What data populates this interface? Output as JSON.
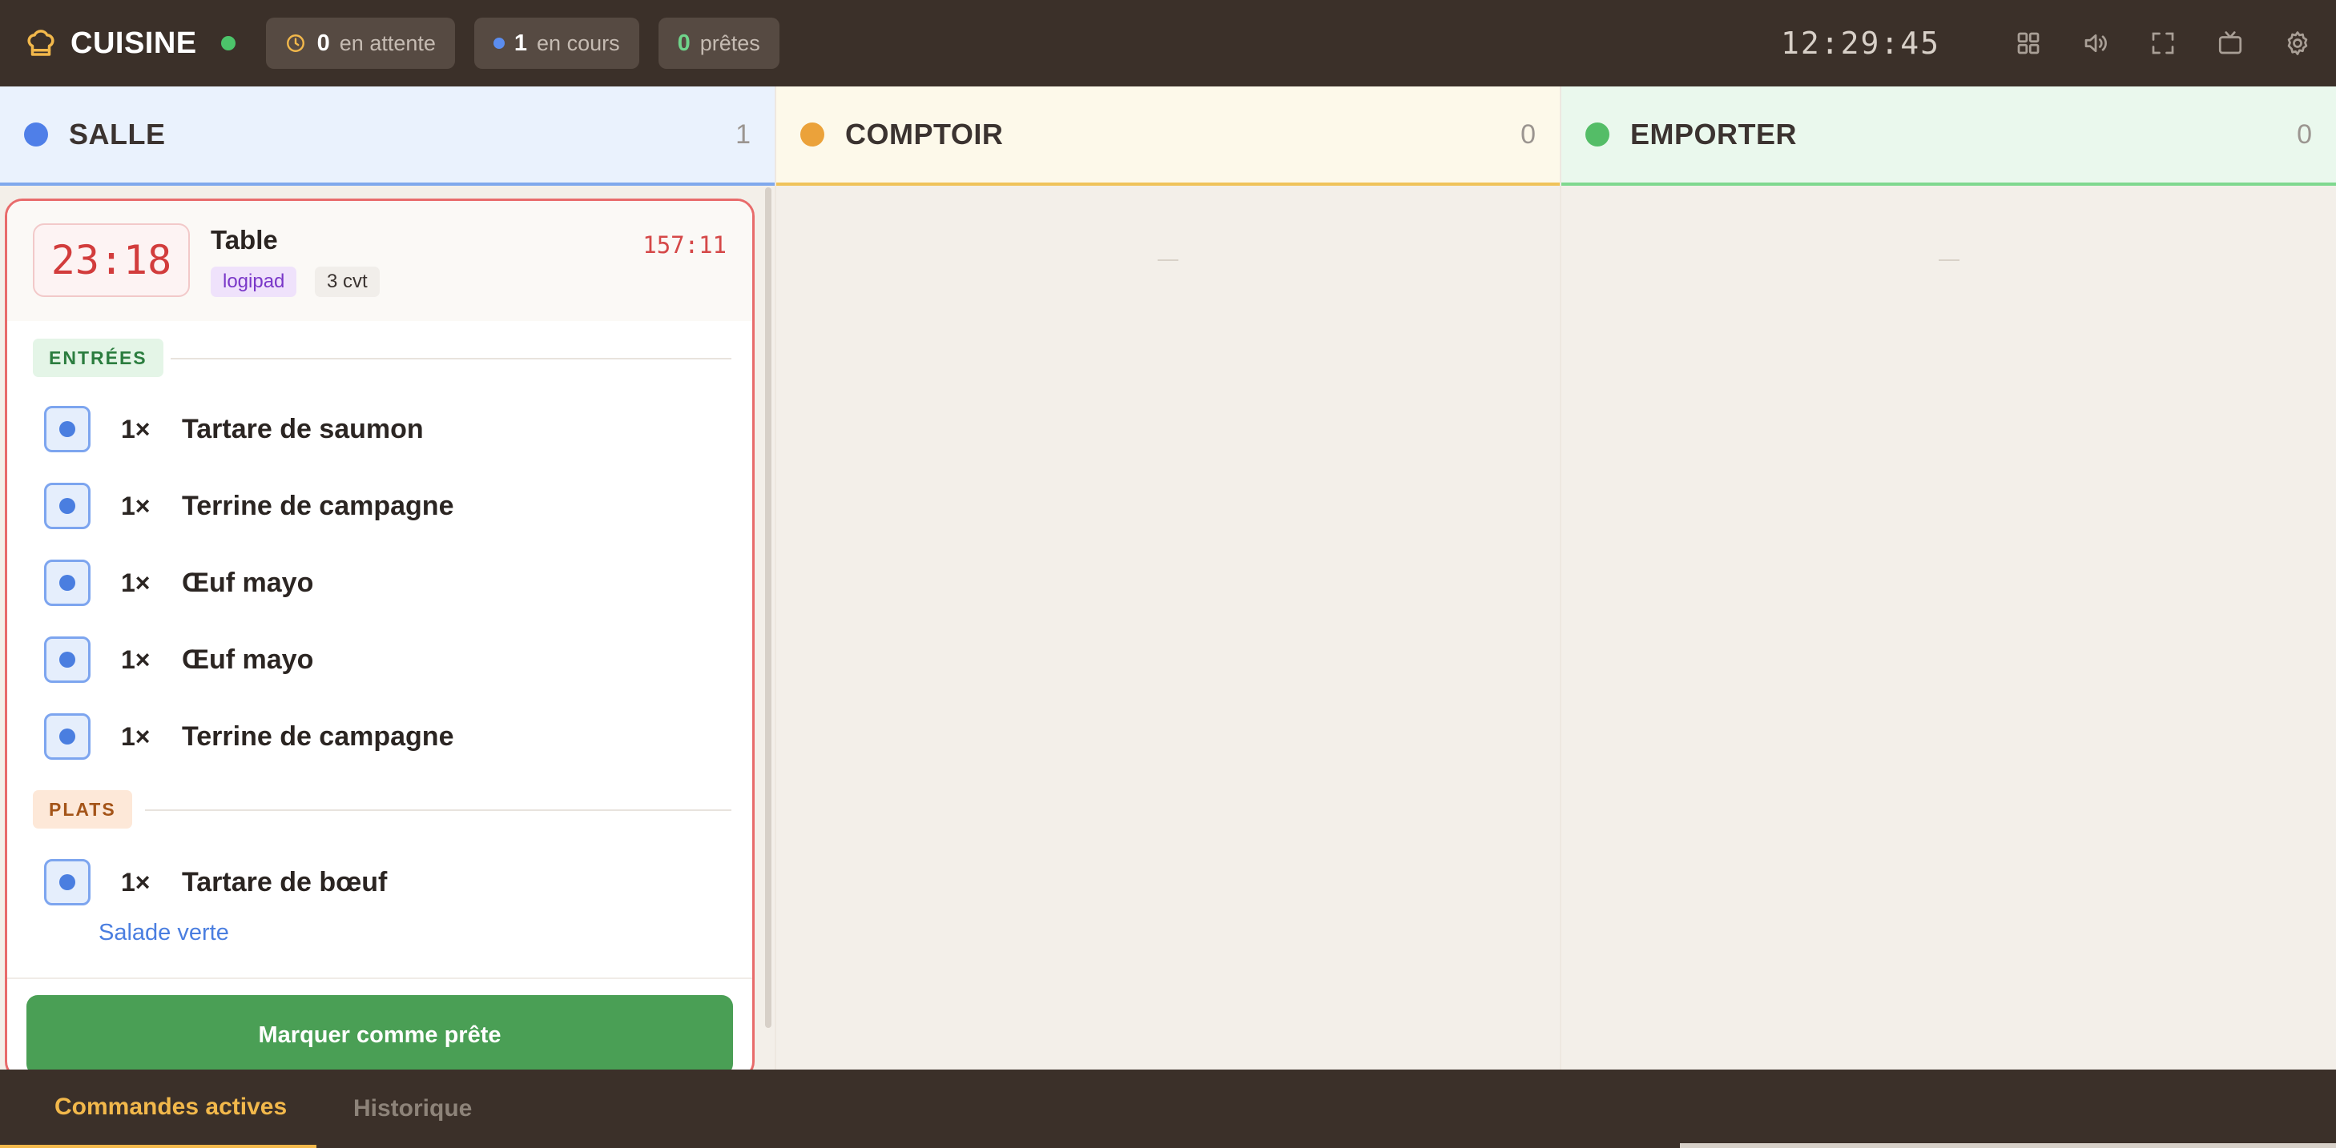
{
  "header": {
    "title": "CUISINE",
    "stats": {
      "waiting": {
        "count": "0",
        "label": "en attente"
      },
      "in_progress": {
        "count": "1",
        "label": "en cours"
      },
      "ready": {
        "count": "0",
        "label": "prêtes"
      }
    },
    "time": "12:29:45",
    "tools": [
      "grid-icon",
      "volume-icon",
      "fullscreen-icon",
      "tv-icon",
      "gear-icon"
    ]
  },
  "columns": [
    {
      "title": "SALLE",
      "count": "1",
      "color": "#4f7fe8"
    },
    {
      "title": "COMPTOIR",
      "count": "0",
      "color": "#eba23a"
    },
    {
      "title": "EMPORTER",
      "count": "0",
      "color": "#54bd67"
    }
  ],
  "order": {
    "timer": "23:18",
    "title": "Table",
    "source_tag": "logipad",
    "covers_tag": "3 cvt",
    "elapsed": "157:11",
    "sections": [
      {
        "label": "ENTRÉES",
        "items": [
          {
            "qty": "1×",
            "name": "Tartare de saumon"
          },
          {
            "qty": "1×",
            "name": "Terrine de campagne"
          },
          {
            "qty": "1×",
            "name": "Œuf mayo"
          },
          {
            "qty": "1×",
            "name": "Œuf mayo"
          },
          {
            "qty": "1×",
            "name": "Terrine de campagne"
          }
        ]
      },
      {
        "label": "PLATS",
        "items": [
          {
            "qty": "1×",
            "name": "Tartare de bœuf",
            "modifier": "Salade verte"
          }
        ]
      }
    ],
    "action_label": "Marquer comme prête"
  },
  "tabs": {
    "active": "Commandes actives",
    "history": "Historique"
  }
}
